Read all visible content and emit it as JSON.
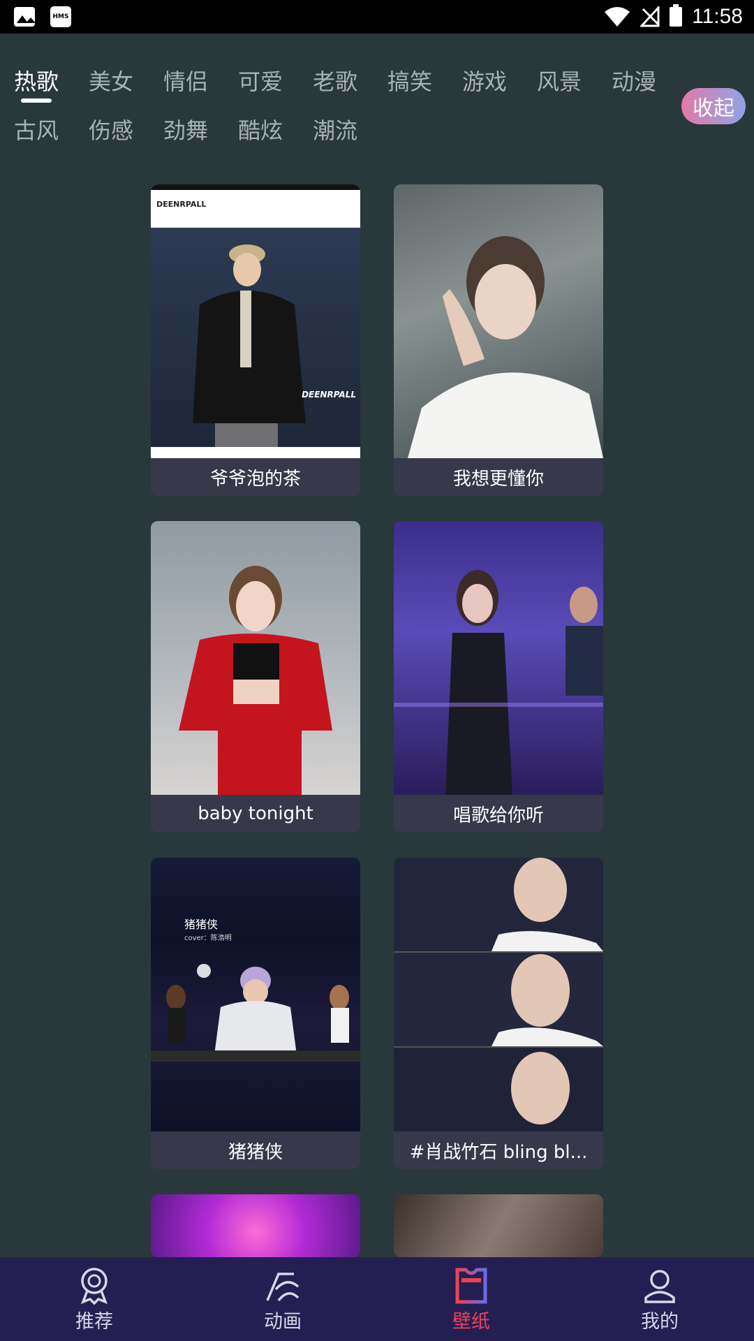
{
  "status_bar": {
    "time": "11:58",
    "left_icons": [
      "gallery-icon",
      "hms-icon"
    ],
    "hms_label": "HMS",
    "right_icons": [
      "wifi-icon",
      "no-signal-icon",
      "battery-icon"
    ]
  },
  "categories": {
    "row1": [
      "热歌",
      "美女",
      "情侣",
      "可爱",
      "老歌",
      "搞笑",
      "游戏",
      "风景",
      "动漫"
    ],
    "row2": [
      "古风",
      "伤感",
      "劲舞",
      "酷炫",
      "潮流"
    ],
    "active": "热歌",
    "collapse_label": "收起"
  },
  "cards": [
    {
      "title": "爷爷泡的茶",
      "brand_text": "DEENRPALL",
      "brand_text_2": "DEENRPALL"
    },
    {
      "title": "我想更懂你"
    },
    {
      "title": "baby tonight"
    },
    {
      "title": "唱歌给你听"
    },
    {
      "title": "猪猪侠",
      "overlay_title": "猪猪侠",
      "overlay_sub": "cover：陈浩明"
    },
    {
      "title": "#肖战竹石 bling bl..."
    },
    {
      "title": ""
    },
    {
      "title": ""
    }
  ],
  "bottom_nav": [
    {
      "label": "推荐",
      "icon": "award-icon"
    },
    {
      "label": "动画",
      "icon": "animation-icon"
    },
    {
      "label": "壁纸",
      "icon": "tshirt-icon",
      "active": true
    },
    {
      "label": "我的",
      "icon": "user-icon"
    }
  ],
  "colors": {
    "background": "#29383a",
    "nav_background": "#241f52",
    "active_nav": "#f0405a",
    "card_caption": "#37394a"
  }
}
